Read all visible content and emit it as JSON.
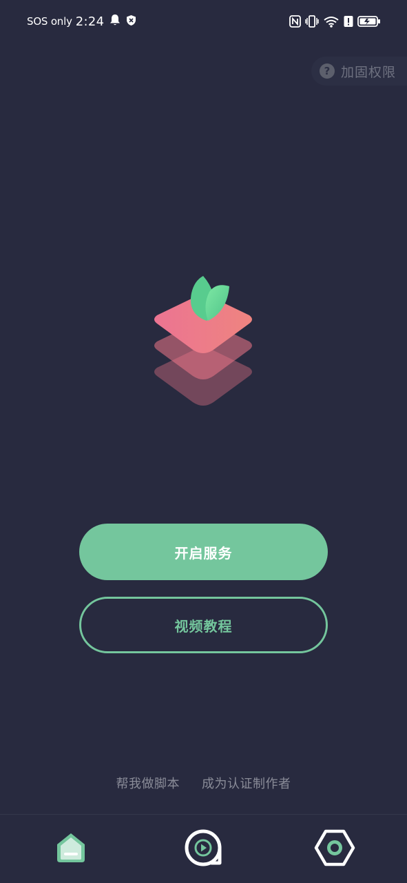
{
  "status_bar": {
    "carrier": "SOS only",
    "time": "2:24",
    "left_icons": [
      "bell-icon",
      "shield-icon"
    ],
    "right_icons": [
      "nfc-icon",
      "vibrate-icon",
      "wifi-icon",
      "alert-icon",
      "battery-icon"
    ]
  },
  "permission": {
    "label": "加固权限",
    "icon": "help-icon",
    "icon_glyph": "?"
  },
  "actions": {
    "start_service": "开启服务",
    "video_tutorial": "视频教程"
  },
  "links": {
    "help_script": "帮我做脚本",
    "become_author": "成为认证制作者"
  },
  "nav": {
    "items": [
      {
        "id": "home",
        "icon": "home-icon",
        "active": true
      },
      {
        "id": "video",
        "icon": "play-circle-icon",
        "active": false
      },
      {
        "id": "settings",
        "icon": "hexagon-gear-icon",
        "active": false
      }
    ]
  },
  "colors": {
    "background": "#282a3f",
    "accent": "#74c69d",
    "logo_pink": "#ee7688",
    "logo_leaf": "#63d493"
  }
}
